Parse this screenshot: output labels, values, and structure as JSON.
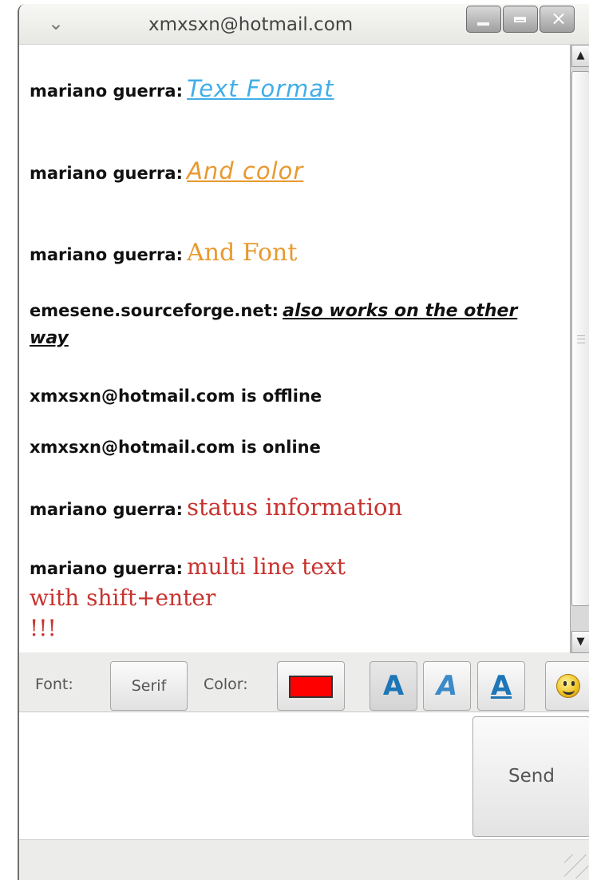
{
  "window": {
    "title": "xmxsxn@hotmail.com",
    "minimize": "minimize",
    "maximize": "maximize",
    "close": "close"
  },
  "messages": [
    {
      "sender": "mariano guerra:",
      "text": "Text Format"
    },
    {
      "sender": "mariano guerra:",
      "text": "And color"
    },
    {
      "sender": "mariano guerra:",
      "text": "And Font"
    },
    {
      "sender": "emesene.sourceforge.net:",
      "text": "also works on the other way"
    },
    {
      "status": "xmxsxn@hotmail.com is offline"
    },
    {
      "status": "xmxsxn@hotmail.com is online"
    },
    {
      "sender": "mariano guerra:",
      "text": "status information"
    },
    {
      "sender": "mariano guerra:",
      "text": "multi line text",
      "continuation": [
        "with shift+enter",
        "!!!"
      ]
    }
  ],
  "toolbar": {
    "font_label": "Font:",
    "font_value": "Serif",
    "color_label": "Color:",
    "color_value": "#ff0000",
    "bold_glyph": "A",
    "italic_glyph": "A",
    "underline_glyph": "A",
    "emoticon_icon": "smiley-icon"
  },
  "composer": {
    "value": "",
    "send_label": "Send"
  },
  "colors": {
    "blue_message": "#42aee8",
    "orange_message": "#e8992f",
    "red_message": "#c8332f"
  }
}
